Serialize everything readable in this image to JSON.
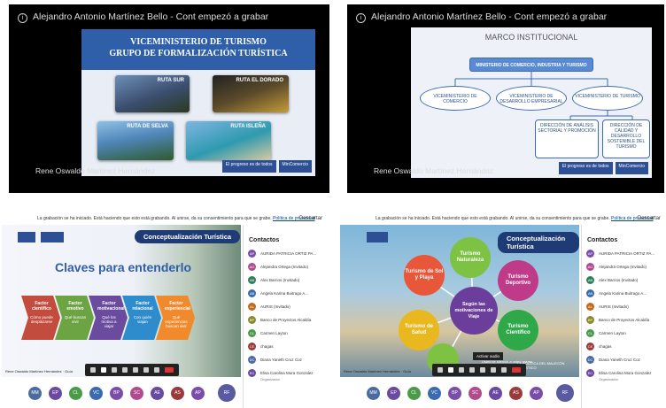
{
  "panels": [
    {
      "window_title": "Alejandro Antonio Martínez Bello - Cont empezó a grabar",
      "speaker": "Rene Oswaldo Martínez Hernández",
      "slide": {
        "title_line1": "VICEMINISTERIO DE TURISMO",
        "title_line2": "GRUPO DE FORMALIZACIÓN TURÍSTICA",
        "routes": [
          "RUTA SUR",
          "RUTA EL DORADO",
          "RUTA DE SELVA",
          "RUTA ISLEÑA"
        ]
      },
      "logos": [
        "El progreso es de todos",
        "MinComercio"
      ]
    },
    {
      "window_title": "Alejandro Antonio Martínez Bello - Cont empezó a grabar",
      "speaker": "Rene Oswaldo Martínez Hernández",
      "slide": {
        "title": "MARCO INSTITUCIONAL",
        "org": {
          "top": "MINISTERIO DE COMERCIO, INDUSTRIA Y TURISMO",
          "level2": [
            "VICEMINISTERIO DE COMERCIO",
            "VICEMINISTERIO DE DESARROLLO EMPRESARIAL",
            "VICEMINISTERIO DE TURISMO"
          ],
          "level3": [
            "DIRECCIÓN DE ANÁLISIS SECTORIAL Y PROMOCIÓN",
            "DIRECCIÓN DE CALIDAD Y DESARROLLO SOSTENIBLE DEL TURISMO"
          ]
        }
      },
      "logos": [
        "El progreso es de todos",
        "MinComercio"
      ]
    },
    {
      "banner": "La grabación se ha iniciado. Está haciendo que esto está grabando. Al unirse, da su consentimiento para que se grabe.",
      "banner_link": "Política de privacidad",
      "banner_close": "Descartar",
      "slide_title": "Conceptualización Turística",
      "heading": "Claves para entenderlo",
      "factors": [
        {
          "title": "Factor científico",
          "text": "Cómo puede desplazarse",
          "color": "#c24c3e"
        },
        {
          "title": "Factor emotivo",
          "text": "Qué buscan vivir",
          "color": "#6da443"
        },
        {
          "title": "Factor motivacional",
          "text": "Qué los motiva a viajar",
          "color": "#6a4b9e"
        },
        {
          "title": "Factor relacional",
          "text": "Con quién viajan",
          "color": "#2e8ccc"
        },
        {
          "title": "Factor experiencial",
          "text": "Qué experiencias buscan vivir",
          "color": "#f08a2c"
        }
      ],
      "contacts_title": "Contactos",
      "contacts": [
        {
          "initials": "AP",
          "name": "AURIDA PATRICIA ORTIZ PA...",
          "color": "#7a4ea8"
        },
        {
          "initials": "AO",
          "name": "Alejandra Ortega (Invitado)",
          "color": "#b24a8e"
        },
        {
          "initials": "AB",
          "name": "Alex Barrios (Invitado)",
          "color": "#2f7f5f"
        },
        {
          "initials": "AB",
          "name": "Angela Karina Buitrago A...",
          "color": "#3a6ab0"
        },
        {
          "initials": "AL",
          "name": "AURIS (Invitado)",
          "color": "#c06a1e"
        },
        {
          "initials": "BP",
          "name": "Banco de Proyectos Alcaldía",
          "color": "#8a8a2a"
        },
        {
          "initials": "CL",
          "name": "Carmen Layton",
          "color": "#4a9a4a"
        },
        {
          "initials": "CE",
          "name": "chagas",
          "color": "#9a3a3a"
        },
        {
          "initials": "DC",
          "name": "Diana Yaneth Cruz Coz",
          "color": "#4a6aa0"
        },
        {
          "initials": "EC",
          "name": "Elisa Carolina Mora Gonzalez",
          "color": "#6a4aa0"
        }
      ],
      "contact_note": "Organizador",
      "participants": [
        "MM",
        "EP",
        "CL",
        "VC",
        "BP",
        "SC",
        "AE",
        "AS",
        "AP",
        "RF"
      ],
      "presenter_caption": "Rene Oswaldo Martínez Hernández · Guía"
    },
    {
      "banner": "La grabación se ha iniciado. Está haciendo que esto está grabando. Al unirse, da su consentimiento para que se grabe.",
      "banner_link": "Política de privacidad",
      "banner_close": "Descartar",
      "slide_title": "Conceptualización Turística",
      "center": "Según las motivaciones de Viaje",
      "bubbles": [
        {
          "label": "Turismo Naturaleza",
          "color": "#7dc242"
        },
        {
          "label": "Turismo Deportivo",
          "color": "#c03a8a"
        },
        {
          "label": "Turismo Científico",
          "color": "#2fa84a"
        },
        {
          "label": "Turismo de Salud",
          "color": "#e8b81e"
        },
        {
          "label": "Turismo de Sol y Playa",
          "color": "#e8573a"
        },
        {
          "label": "Turismo de Aventura",
          "color": "#1fa9b5"
        }
      ],
      "tooltip": "Activar audio",
      "unmute_note": "Usted se silenció a usted mismo",
      "slide_footer": "LA POLÍTICA DEL MALECÓN TURÍSTICO",
      "contacts_title": "Contactos",
      "contacts": [
        {
          "initials": "AP",
          "name": "AURIDA PATRICIA ORTIZ PA...",
          "color": "#7a4ea8"
        },
        {
          "initials": "AO",
          "name": "Alejandra Ortega (Invitado)",
          "color": "#b24a8e"
        },
        {
          "initials": "AB",
          "name": "Alex Barrios (Invitado)",
          "color": "#2f7f5f"
        },
        {
          "initials": "AB",
          "name": "Angela Karina Buitrago A...",
          "color": "#3a6ab0"
        },
        {
          "initials": "AL",
          "name": "AURIS (Invitado)",
          "color": "#c06a1e"
        },
        {
          "initials": "BP",
          "name": "Banco de Proyectos Alcaldía",
          "color": "#8a8a2a"
        },
        {
          "initials": "CL",
          "name": "Carmen Layton",
          "color": "#4a9a4a"
        },
        {
          "initials": "CE",
          "name": "chagas",
          "color": "#9a3a3a"
        },
        {
          "initials": "DC",
          "name": "Diana Yaneth Cruz Coz",
          "color": "#4a6aa0"
        },
        {
          "initials": "EC",
          "name": "Elisa Carolina Mora Gonzalez",
          "color": "#6a4aa0"
        }
      ],
      "contact_note": "Organizador",
      "participants": [
        "MM",
        "EP",
        "CL",
        "VC",
        "BP",
        "SC",
        "AE",
        "AS",
        "AP",
        "RF"
      ],
      "presenter_caption": "Rene Oswaldo Martínez Hernández · Guía"
    }
  ]
}
